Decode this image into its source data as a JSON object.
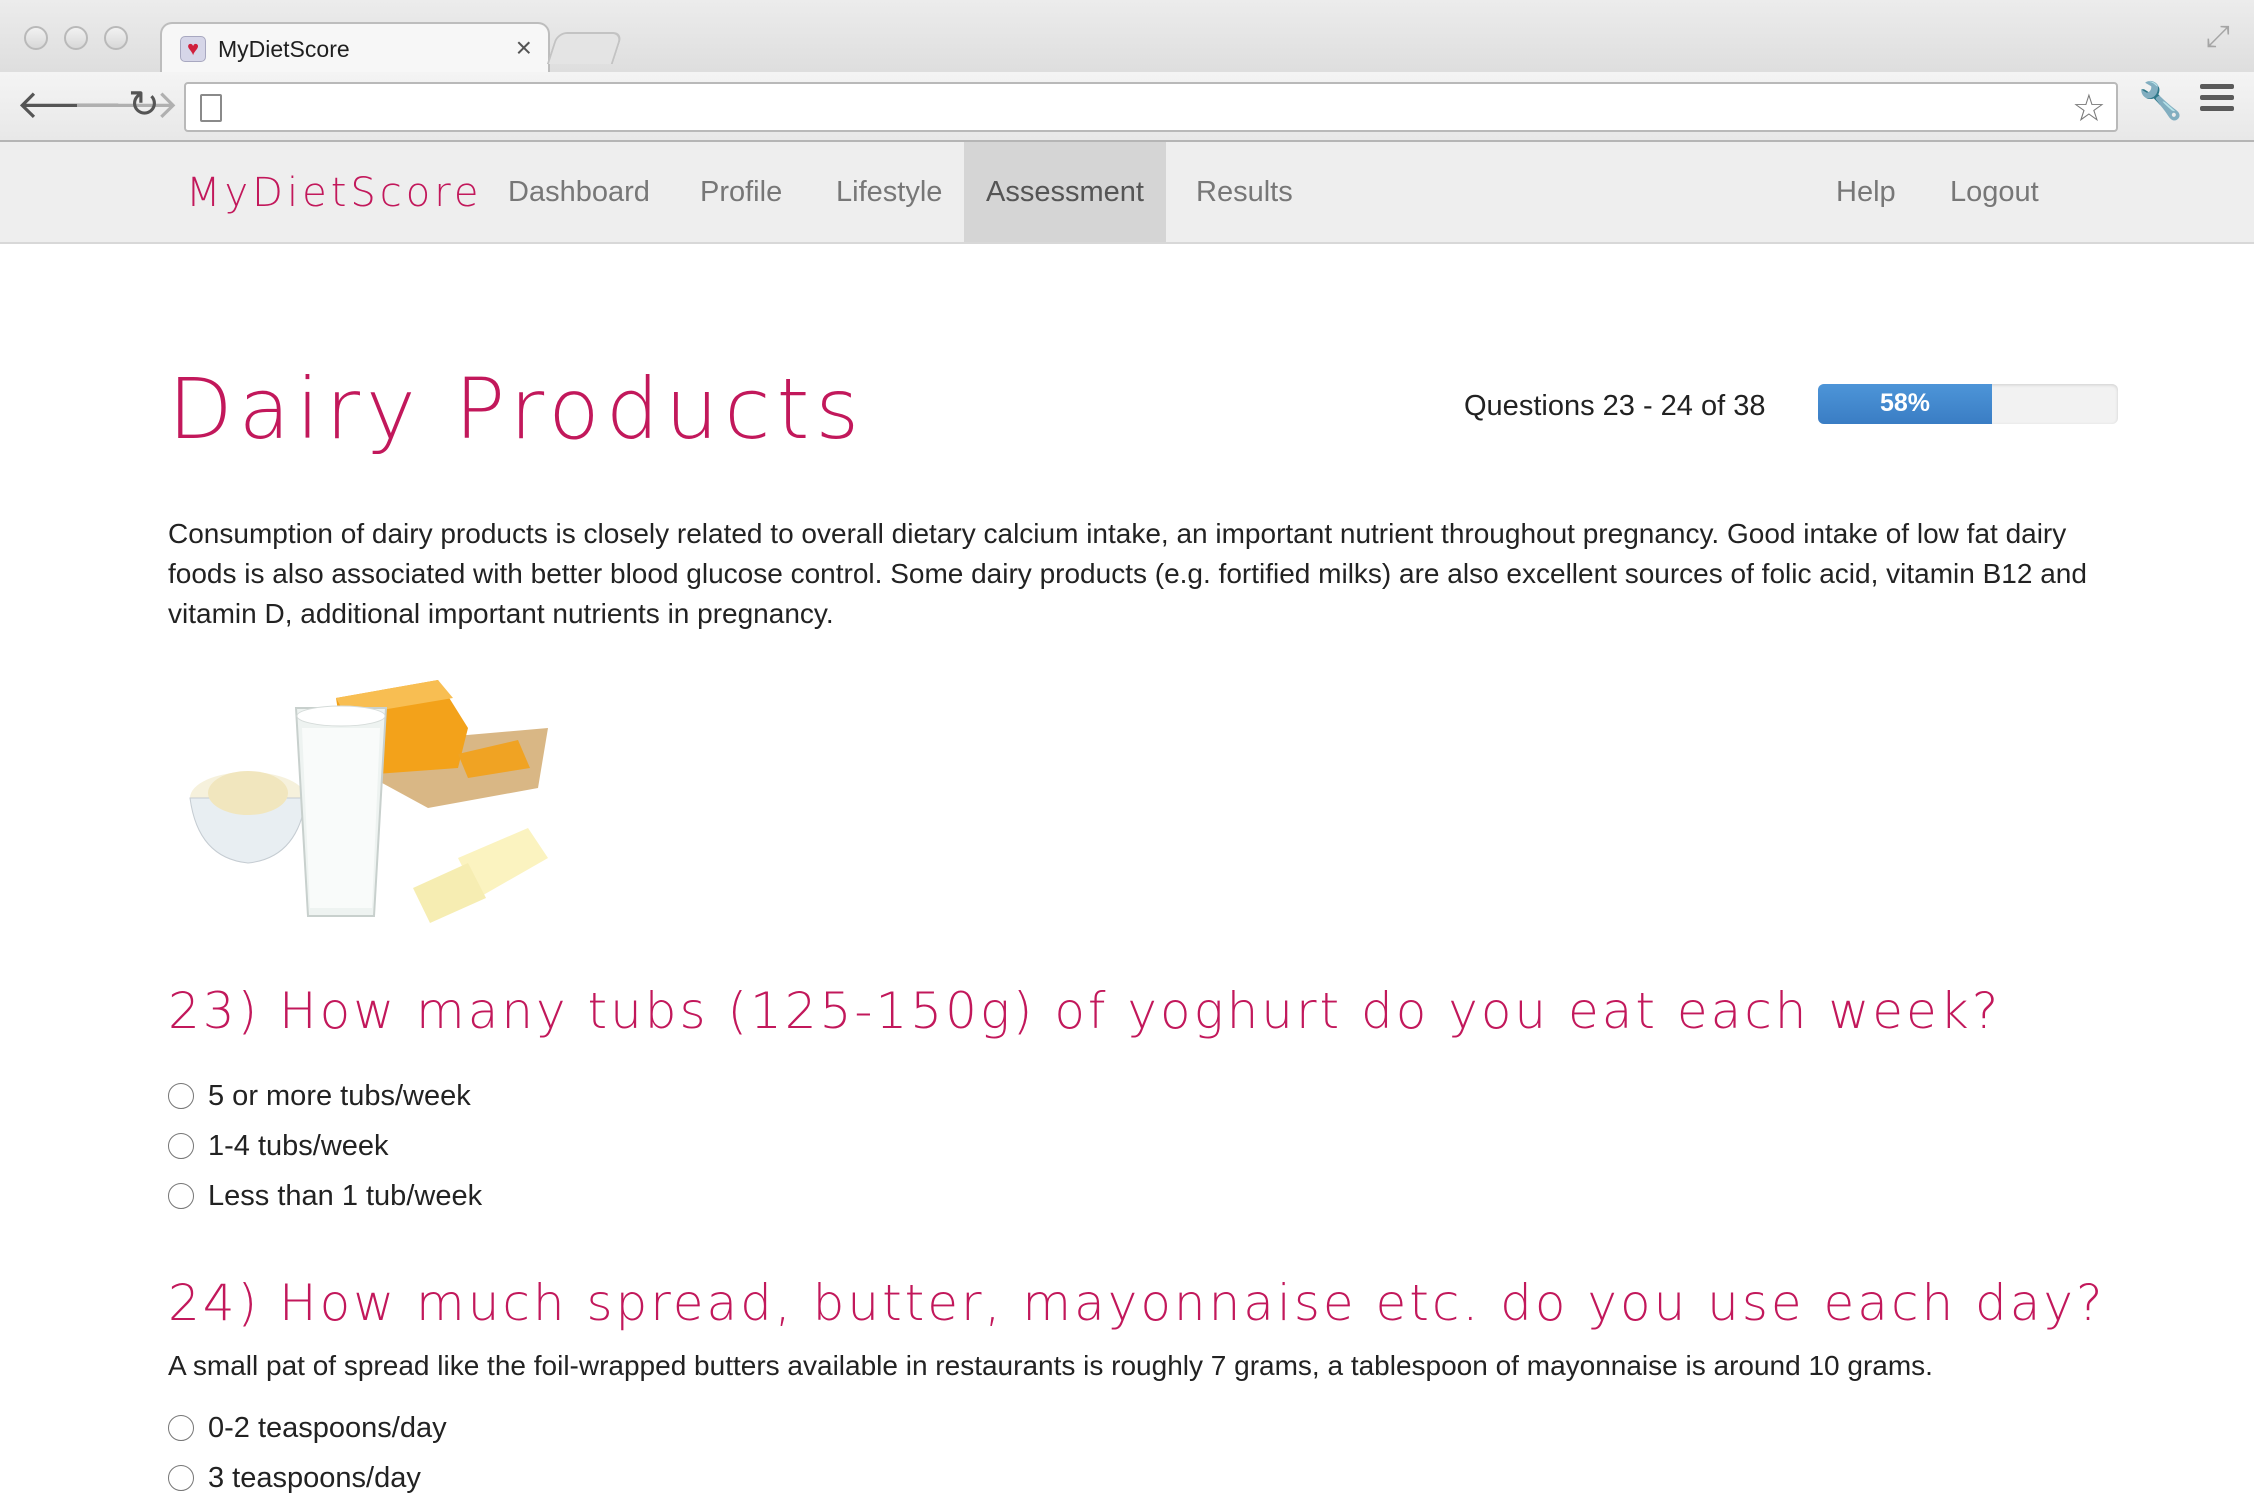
{
  "browser": {
    "tab_title": "MyDietScore",
    "tab_close_glyph": "×",
    "url": "",
    "icons": [
      "back-icon",
      "forward-icon",
      "reload-icon",
      "page-icon",
      "bookmark-star-icon",
      "wrench-icon",
      "menu-icon",
      "fullscreen-icon"
    ]
  },
  "navbar": {
    "brand": "MyDietScore",
    "items": [
      {
        "label": "Dashboard"
      },
      {
        "label": "Profile"
      },
      {
        "label": "Lifestyle"
      },
      {
        "label": "Assessment",
        "active": true
      },
      {
        "label": "Results"
      }
    ],
    "right_items": [
      {
        "label": "Help"
      },
      {
        "label": "Logout"
      }
    ]
  },
  "page": {
    "title": "Dairy Products",
    "question_count": "Questions 23 - 24 of 38",
    "progress_label": "58%",
    "progress_fraction": 0.58,
    "intro": "Consumption of dairy products is closely related to overall dietary calcium intake, an important nutrient throughout pregnancy. Good intake of low fat dairy foods is also associated with better blood glucose control. Some dairy products (e.g. fortified milks) are also excellent sources of folic acid, vitamin B12 and vitamin D, additional important nutrients in pregnancy."
  },
  "questions": [
    {
      "title": "23) How many tubs (125-150g) of yoghurt do you eat each week?",
      "options": [
        "5 or more tubs/week",
        "1-4 tubs/week",
        "Less than 1 tub/week"
      ]
    },
    {
      "title": "24) How much spread, butter, mayonnaise etc. do you use each day?",
      "note": "A small pat of spread like the foil-wrapped butters available in restaurants is roughly 7 grams, a tablespoon of mayonnaise is around 10 grams.",
      "options": [
        "0-2 teaspoons/day",
        "3 teaspoons/day"
      ]
    }
  ],
  "colors": {
    "brand": "#c2185b",
    "progress": "#3a7dc4",
    "nav_active": "#d5d5d5"
  }
}
